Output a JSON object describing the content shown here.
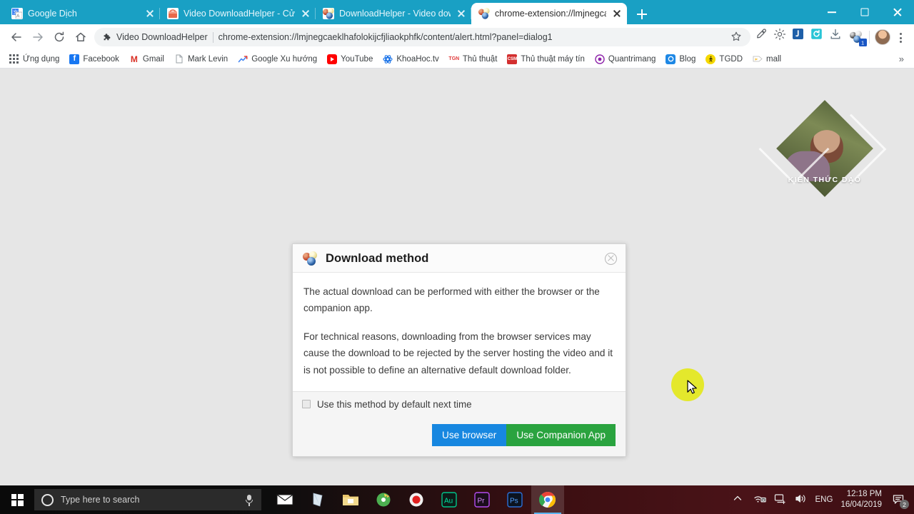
{
  "browser": {
    "tabs": [
      {
        "title": "Google Dịch",
        "favicon": "google-translate-icon",
        "active": false
      },
      {
        "title": "Video DownloadHelper - Cửa hà",
        "favicon": "chrome-webstore-icon",
        "active": false
      },
      {
        "title": "DownloadHelper - Video downlo",
        "favicon": "downloadhelper-icon",
        "active": false
      },
      {
        "title": "chrome-extension://lmjnegcaekl",
        "favicon": "downloadhelper-icon",
        "active": true
      }
    ],
    "new_tab_label": "+",
    "window_controls": {
      "minimize": "minimize-icon",
      "maximize": "maximize-icon",
      "close": "close-icon"
    },
    "toolbar": {
      "back": "back-arrow-icon",
      "forward": "forward-arrow-icon",
      "reload": "reload-icon",
      "home": "home-icon",
      "extension_chip": "Video DownloadHelper",
      "url": "chrome-extension://lmjnegcaeklhafolokijcfjliaokphfk/content/alert.html?panel=dialog1",
      "bookmark_star": "star-icon",
      "extensions": [
        "eyedropper-icon",
        "gear-extension-icon",
        "idm-extension-icon",
        "refresh-extension-icon",
        "download-extension-icon",
        "downloadhelper-extension-icon"
      ],
      "profile_avatar": "avatar",
      "menu": "kebab-menu-icon"
    },
    "bookmarks": [
      {
        "label": "Ứng dụng",
        "icon": "apps-grid-icon",
        "color": "#5f6368"
      },
      {
        "label": "Facebook",
        "icon": "facebook-icon",
        "color": "#1877f2"
      },
      {
        "label": "Gmail",
        "icon": "gmail-icon",
        "color": "#d93025"
      },
      {
        "label": "Mark Levin",
        "icon": "document-icon",
        "color": "#9aa0a6"
      },
      {
        "label": "Google Xu hướng",
        "icon": "trends-icon",
        "color": "#4285f4"
      },
      {
        "label": "YouTube",
        "icon": "youtube-icon",
        "color": "#ff0000"
      },
      {
        "label": "KhoaHoc.tv",
        "icon": "khoahoc-icon",
        "color": "#1a73e8"
      },
      {
        "label": "Thủ thuật",
        "icon": "thuthuat-icon",
        "color": "#e03a3a"
      },
      {
        "label": "Thủ thuật máy tín",
        "icon": "thuthuatmaytinh-icon",
        "color": "#d32f2f"
      },
      {
        "label": "Quantrimang",
        "icon": "quantrimang-icon",
        "color": "#8e24aa"
      },
      {
        "label": "Blog",
        "icon": "blog-icon",
        "color": "#1e88e5"
      },
      {
        "label": "TGDD",
        "icon": "tgdd-icon",
        "color": "#f5d800"
      },
      {
        "label": "mall",
        "icon": "note-icon",
        "color": "#f6c244"
      }
    ],
    "bookmarks_overflow": "»"
  },
  "watermark": {
    "text": "KIẾN THỨC DẠO"
  },
  "dialog": {
    "icon": "downloadhelper-balls-icon",
    "title": "Download method",
    "close_label": "close-icon",
    "paragraphs": [
      "The actual download can be performed with either the browser or the companion app.",
      "For technical reasons, downloading from the browser services may cause the download to be rejected by the server hosting the video and it is not possible to define an alternative default download folder."
    ],
    "checkbox": {
      "label": "Use this method by default next time",
      "checked": false
    },
    "buttons": {
      "browser": "Use browser",
      "companion": "Use Companion App"
    },
    "colors": {
      "browser_btn": "#1787e0",
      "companion_btn": "#2aa33f"
    }
  },
  "taskbar": {
    "start": "windows-start-icon",
    "search_placeholder": "Type here to search",
    "cortana": "cortana-icon",
    "mic": "microphone-icon",
    "apps": [
      {
        "name": "mail-icon"
      },
      {
        "name": "sticky-notes-icon"
      },
      {
        "name": "file-explorer-icon"
      },
      {
        "name": "cd-burner-icon"
      },
      {
        "name": "record-icon"
      },
      {
        "name": "adobe-audition-icon",
        "label": "Au"
      },
      {
        "name": "adobe-premiere-icon",
        "label": "Pr"
      },
      {
        "name": "adobe-photoshop-icon",
        "label": "Ps"
      },
      {
        "name": "google-chrome-icon",
        "active": true
      }
    ],
    "tray": {
      "show_hidden": "chevron-up-icon",
      "network_icon": "network-offline-icon",
      "display_icon": "display-icon",
      "volume_icon": "volume-icon",
      "language": "ENG",
      "time": "12:18 PM",
      "date": "16/04/2019",
      "notifications_icon": "action-center-icon",
      "notifications_count": "2"
    }
  }
}
